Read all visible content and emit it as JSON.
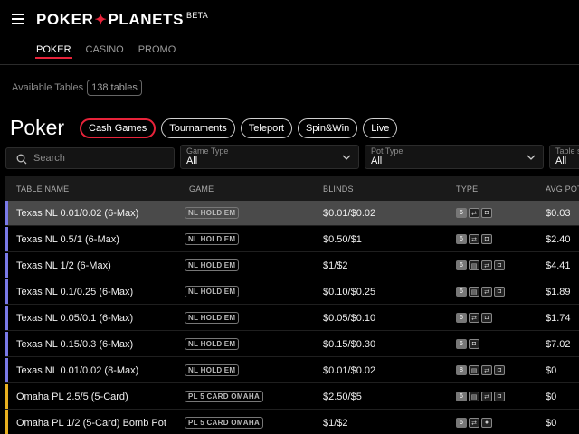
{
  "header": {
    "logo_left": "POKER",
    "logo_right": "PLANETS",
    "beta": "BETA"
  },
  "nav": {
    "tabs": [
      {
        "label": "POKER",
        "active": true
      },
      {
        "label": "CASINO",
        "active": false
      },
      {
        "label": "PROMO",
        "active": false
      }
    ]
  },
  "summary": {
    "label": "Available Tables",
    "count": "138 tables"
  },
  "section": {
    "title": "Poker",
    "chips": [
      {
        "label": "Cash Games",
        "active": true
      },
      {
        "label": "Tournaments",
        "active": false
      },
      {
        "label": "Teleport",
        "active": false
      },
      {
        "label": "Spin&Win",
        "active": false
      },
      {
        "label": "Live",
        "active": false
      }
    ]
  },
  "filters": {
    "search_placeholder": "Search",
    "game_type": {
      "label": "Game Type",
      "value": "All"
    },
    "pot_type": {
      "label": "Pot Type",
      "value": "All"
    },
    "table_size": {
      "label": "Table s",
      "value": "All"
    }
  },
  "table": {
    "columns": [
      "TABLE NAME",
      "GAME",
      "BLINDS",
      "TYPE",
      "AVG POT"
    ],
    "rows": [
      {
        "name": "Texas NL 0.01/0.02 (6-Max)",
        "game": "NL HOLD'EM",
        "blinds": "$0.01/$0.02",
        "type_count": "6",
        "type_icons": [
          "swap-icon",
          "shield-icon"
        ],
        "avg_pot": "$0.03",
        "accent": "#7a7ae8",
        "selected": true
      },
      {
        "name": "Texas NL 0.5/1 (6-Max)",
        "game": "NL HOLD'EM",
        "blinds": "$0.50/$1",
        "type_count": "6",
        "type_icons": [
          "swap-icon",
          "shield-icon"
        ],
        "avg_pot": "$2.40",
        "accent": "#7a7ae8",
        "selected": false
      },
      {
        "name": "Texas NL 1/2 (6-Max)",
        "game": "NL HOLD'EM",
        "blinds": "$1/$2",
        "type_count": "6",
        "type_icons": [
          "table-icon",
          "swap-icon",
          "shield-icon"
        ],
        "avg_pot": "$4.41",
        "accent": "#7a7ae8",
        "selected": false
      },
      {
        "name": "Texas NL 0.1/0.25 (6-Max)",
        "game": "NL HOLD'EM",
        "blinds": "$0.10/$0.25",
        "type_count": "6",
        "type_icons": [
          "table-icon",
          "swap-icon",
          "shield-icon"
        ],
        "avg_pot": "$1.89",
        "accent": "#7a7ae8",
        "selected": false
      },
      {
        "name": "Texas NL 0.05/0.1 (6-Max)",
        "game": "NL HOLD'EM",
        "blinds": "$0.05/$0.10",
        "type_count": "6",
        "type_icons": [
          "swap-icon",
          "shield-icon"
        ],
        "avg_pot": "$1.74",
        "accent": "#7a7ae8",
        "selected": false
      },
      {
        "name": "Texas NL 0.15/0.3 (6-Max)",
        "game": "NL HOLD'EM",
        "blinds": "$0.15/$0.30",
        "type_count": "6",
        "type_icons": [
          "shield-icon"
        ],
        "avg_pot": "$7.02",
        "accent": "#7a7ae8",
        "selected": false
      },
      {
        "name": "Texas NL 0.01/0.02 (8-Max)",
        "game": "NL HOLD'EM",
        "blinds": "$0.01/$0.02",
        "type_count": "8",
        "type_icons": [
          "table-icon",
          "swap-icon",
          "shield-icon"
        ],
        "avg_pot": "$0",
        "accent": "#7a7ae8",
        "selected": false
      },
      {
        "name": "Omaha PL 2.5/5 (5-Card)",
        "game": "PL 5 CARD OMAHA",
        "blinds": "$2.50/$5",
        "type_count": "6",
        "type_icons": [
          "table-icon",
          "swap-icon",
          "shield-icon"
        ],
        "avg_pot": "$0",
        "accent": "#e8b020",
        "selected": false
      },
      {
        "name": "Omaha PL 1/2 (5-Card) Bomb Pot",
        "game": "PL 5 CARD OMAHA",
        "blinds": "$1/$2",
        "type_count": "6",
        "type_icons": [
          "swap-icon",
          "bomb-icon"
        ],
        "avg_pot": "$0",
        "accent": "#e8b020",
        "selected": false
      }
    ]
  },
  "colors": {
    "accent_red": "#e8233a",
    "holdem_bar": "#7a7ae8",
    "omaha_bar": "#e8b020"
  }
}
